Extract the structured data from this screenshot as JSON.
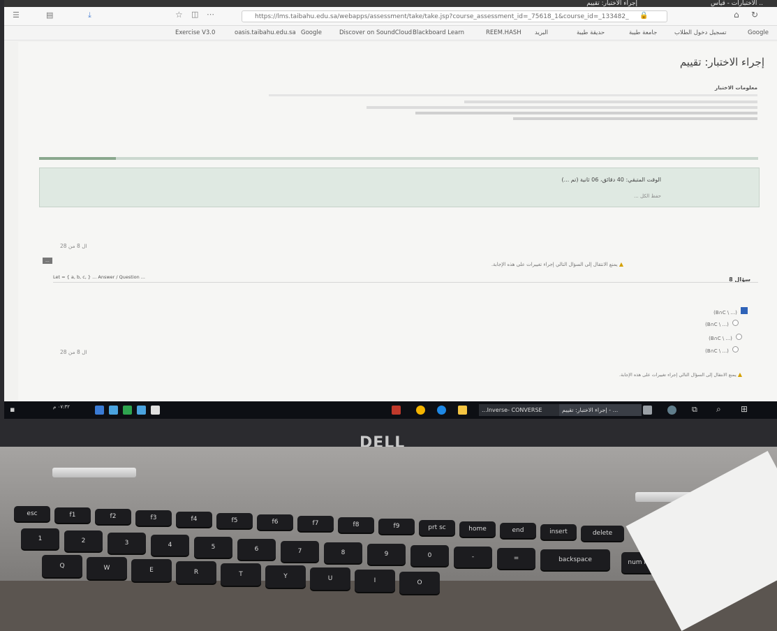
{
  "browser": {
    "tabs": [
      "الاختبارات - قياس ..",
      "إجراء الاختبار: تقييم"
    ],
    "url": "https://lms.taibahu.edu.sa/webapps/assessment/take/take.jsp?course_assessment_id=_75618_1&course_id=_133482_",
    "bookmarks": [
      "Exercise V3.0",
      "oasis.taibahu.edu.sa",
      "Google",
      "Discover on SoundCloud",
      "Blackboard Learn",
      "REEM.HASH",
      "البريد",
      "حديقة طيبة",
      "جامعة طيبة",
      "تسجيل دخول الطلاب",
      "تسجيل دخول الطلاب",
      "Google"
    ]
  },
  "page": {
    "title": "إجراء الاختبار: تقييم",
    "info_heading": "معلومات الاختبار",
    "timer_text": "الوقت المتبقي: 40 دقائق، 06 ثانية (تم ...)",
    "save_all": "حفظ الكل ...",
    "question_counter": "ال 8 من 28",
    "nav_button": "...",
    "question_label": "سؤال 8",
    "warning_text": "يمنع الانتقال إلى السؤال التالي إجراء تغييرات على هذه الإجابة.",
    "question_text": "Let  = { a, b, c, } ... Answer / Question ...",
    "options": [
      "(B∩C \\ ...)",
      "(B∩C \\ ...)",
      "(B∩C \\ ...)",
      "(B∩C \\ ...)"
    ],
    "bottom_counter": "ال 8 من 28",
    "bottom_warning": "يمنع الانتقال إلى السؤال التالي إجراء تغييرات على هذه الإجابة."
  },
  "taskbar": {
    "time": "٠٧:٣٢ م",
    "tasks": [
      "...Inverse- CONVERSE",
      "إجراء الاختبار: تقييم - ..."
    ]
  },
  "hardware": {
    "brand": "DELL",
    "keys_fn": [
      "esc",
      "f1",
      "f2",
      "f3",
      "f4",
      "f5",
      "f6",
      "f7",
      "f8",
      "f9",
      "prt sc",
      "home",
      "end",
      "insert",
      "delete"
    ],
    "keys_num": [
      "1",
      "2",
      "3",
      "4",
      "5",
      "6",
      "7",
      "8",
      "9",
      "0",
      "-",
      "=",
      "backspace",
      "num lock"
    ],
    "keys_alpha": [
      "Q",
      "W",
      "E",
      "R",
      "T",
      "Y",
      "U",
      "I",
      "O"
    ]
  },
  "colors": {
    "accent_blue": "#2f63b8",
    "panel_green": "#dfe9e2",
    "warning": "#d4a000"
  }
}
